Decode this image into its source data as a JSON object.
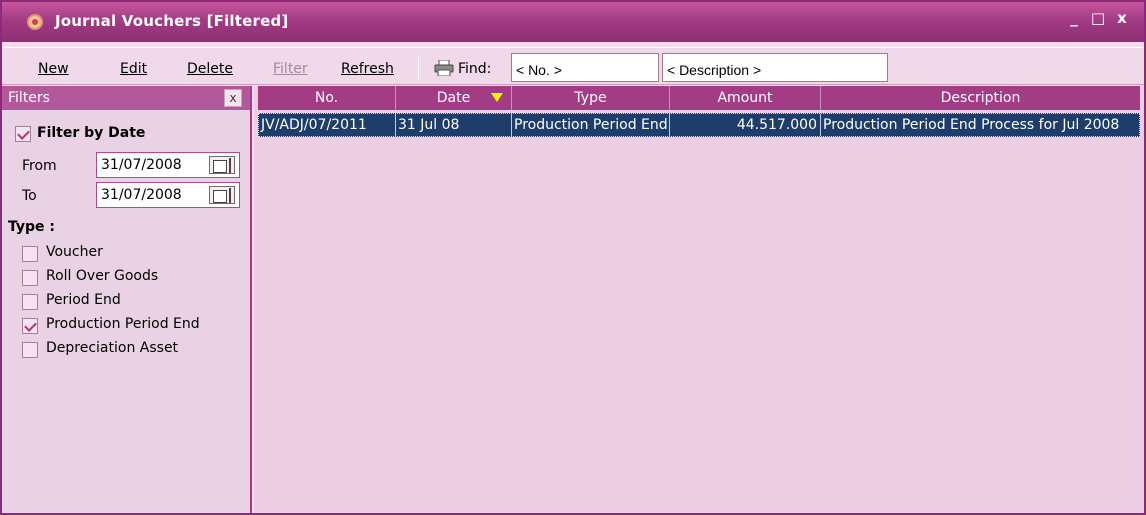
{
  "window": {
    "title": "Journal Vouchers [Filtered]",
    "minimize_label": "_",
    "maximize_label": "□",
    "close_label": "x"
  },
  "toolbar": {
    "new_label": "New",
    "edit_label": "Edit",
    "delete_label": "Delete",
    "filter_label": "Filter",
    "refresh_label": "Refresh",
    "find_label": "Find:",
    "find_no_placeholder": "< No. >",
    "find_description_placeholder": "< Description >"
  },
  "filters": {
    "header": "Filters",
    "close_label": "x",
    "filter_by_date_label": "Filter by Date",
    "filter_by_date_checked": true,
    "from_label": "From",
    "from_value": "31/07/2008",
    "to_label": "To",
    "to_value": "31/07/2008",
    "type_heading": "Type :",
    "types": [
      {
        "label": "Voucher",
        "checked": false
      },
      {
        "label": "Roll Over Goods",
        "checked": false
      },
      {
        "label": "Period End",
        "checked": false
      },
      {
        "label": "Production Period End",
        "checked": true
      },
      {
        "label": "Depreciation Asset",
        "checked": false
      }
    ]
  },
  "grid": {
    "columns": [
      "No.",
      "Date",
      "Type",
      "Amount",
      "Description"
    ],
    "sorted_column": "Date",
    "rows": [
      {
        "no": "JV/ADJ/07/2011",
        "date": "31 Jul 08",
        "type": "Production Period End",
        "amount": "44.517.000",
        "description": "Production Period End Process for Jul 2008",
        "selected": true
      }
    ]
  },
  "colors": {
    "titlebar": "#a23b84",
    "panel_background": "#e9d2e3",
    "grid_background": "#edcee3",
    "selected_row": "#1f3d6a",
    "sort_indicator": "#f7f200"
  }
}
